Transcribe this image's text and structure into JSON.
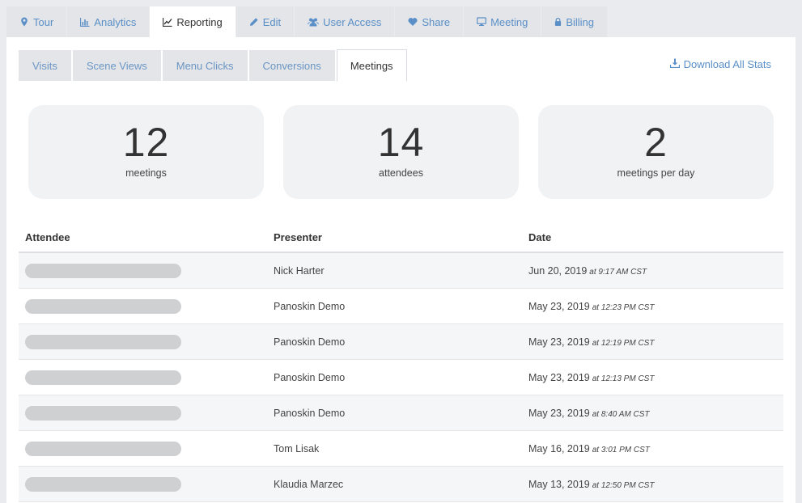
{
  "top_tabs": [
    {
      "label": "Tour",
      "icon": "map-marker-icon"
    },
    {
      "label": "Analytics",
      "icon": "bar-chart-icon"
    },
    {
      "label": "Reporting",
      "icon": "line-chart-icon"
    },
    {
      "label": "Edit",
      "icon": "pencil-icon"
    },
    {
      "label": "User Access",
      "icon": "users-icon"
    },
    {
      "label": "Share",
      "icon": "heart-icon"
    },
    {
      "label": "Meeting",
      "icon": "monitor-icon"
    },
    {
      "label": "Billing",
      "icon": "lock-icon"
    }
  ],
  "active_top_tab": "Reporting",
  "sub_tabs": [
    "Visits",
    "Scene Views",
    "Menu Clicks",
    "Conversions",
    "Meetings"
  ],
  "active_sub_tab": "Meetings",
  "download_label": "Download All Stats",
  "stats": [
    {
      "value": "12",
      "label": "meetings"
    },
    {
      "value": "14",
      "label": "attendees"
    },
    {
      "value": "2",
      "label": "meetings per day"
    }
  ],
  "table": {
    "headers": [
      "Attendee",
      "Presenter",
      "Date"
    ],
    "rows": [
      {
        "presenter": "Nick Harter",
        "date": "Jun 20, 2019",
        "time": "at 9:17 AM CST"
      },
      {
        "presenter": "Panoskin Demo",
        "date": "May 23, 2019",
        "time": "at 12:23 PM CST"
      },
      {
        "presenter": "Panoskin Demo",
        "date": "May 23, 2019",
        "time": "at 12:19 PM CST"
      },
      {
        "presenter": "Panoskin Demo",
        "date": "May 23, 2019",
        "time": "at 12:13 PM CST"
      },
      {
        "presenter": "Panoskin Demo",
        "date": "May 23, 2019",
        "time": "at 8:40 AM CST"
      },
      {
        "presenter": "Tom Lisak",
        "date": "May 16, 2019",
        "time": "at 3:01 PM CST"
      },
      {
        "presenter": "Klaudia Marzec",
        "date": "May 13, 2019",
        "time": "at 12:50 PM CST"
      }
    ]
  },
  "colors": {
    "link": "#5a8fc7",
    "tab_bg": "#e3e5e8",
    "card_bg": "#f1f2f4",
    "redacted": "#cfd0d2"
  }
}
